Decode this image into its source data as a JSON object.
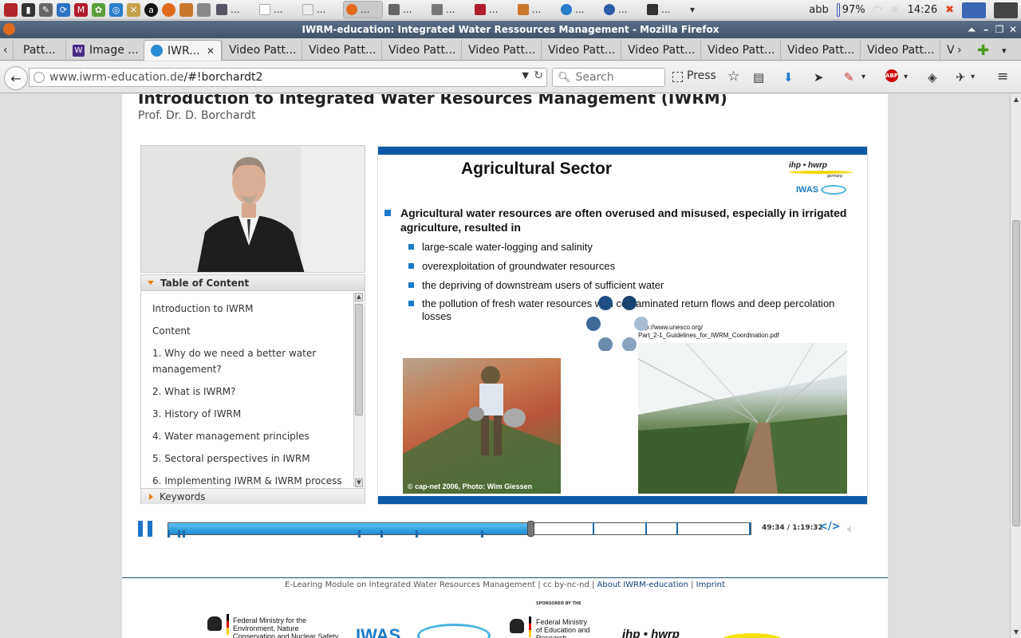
{
  "system_panel": {
    "battery": "97%",
    "clock": "14:26",
    "keyboard": "abb",
    "task_label": "..."
  },
  "window": {
    "title": "IWRM-education: Integrated Water Ressources Management - Mozilla Firefox"
  },
  "tabs": [
    {
      "label": "Patt..."
    },
    {
      "label": "Image ..."
    },
    {
      "label": "IWR..."
    },
    {
      "label": "Video Patt..."
    },
    {
      "label": "Video Patt..."
    },
    {
      "label": "Video Patt..."
    },
    {
      "label": "Video Patt..."
    },
    {
      "label": "Video Patt..."
    },
    {
      "label": "Video Patt..."
    },
    {
      "label": "Video Patt..."
    },
    {
      "label": "Video Patt..."
    },
    {
      "label": "Video Patt..."
    },
    {
      "label": "V"
    }
  ],
  "navbar": {
    "url_host": "www.iwrm-education.de",
    "url_path": "/#!borchardt2",
    "search_placeholder": "Search",
    "press_label": "Press"
  },
  "page": {
    "title": "Introduction to Integrated Water Resources Management (IWRM)",
    "author": "Prof. Dr. D. Borchardt",
    "toc_heading": "Table of Content",
    "toc_items": [
      "Introduction to IWRM",
      "Content",
      "1. Why do we need a better water management?",
      "2. What is IWRM?",
      "3. History of IWRM",
      "4. Water management principles",
      "5. Sectoral perspectives in IWRM",
      "6. Implementing IWRM & IWRM process"
    ],
    "keywords_label": "Keywords"
  },
  "slide": {
    "title": "Agricultural Sector",
    "logo_top": "ihp • hwrp",
    "logo_top_sub": "germany",
    "logo_bottom": "IWAS",
    "main_point": "Agricultural water resources are often overused and misused, especially in irrigated agriculture, resulted in",
    "sub_points": [
      "large-scale water-logging and salinity",
      "overexploitation of groundwater resources",
      "the depriving of downstream users of sufficient water",
      "the pollution of fresh water resources with contaminated return flows and deep percolation losses"
    ],
    "source_url_1": "http://www.unesco.org/",
    "source_url_2": "Part_2-1_Guidelines_for_IWRM_Coordination.pdf",
    "photo_caption": "© cap-net 2006, Photo: Wim Giessen"
  },
  "player": {
    "time": "49:34 / 1:19:32",
    "embed_label": "</>",
    "progress_fraction": 0.623
  },
  "footer": {
    "text": "E-Learing Module on Integrated Water Resources Management | cc by-nc-nd | ",
    "about_link": "About IWRM-education",
    "sep": " | ",
    "imprint_link": "Imprint",
    "sponsored": "SPONSORED BY THE",
    "ministry_env": "Federal Ministry for the Environment, Nature Conservation and Nuclear Safety",
    "ministry_edu": "Federal Ministry of Education and Research",
    "logo_iwas": "IWAS",
    "logo_ihp": "ihp • hwrp"
  },
  "colors": {
    "accent": "#1a74c6",
    "slide_blue": "#0c5aa6",
    "titlebar": "#4d5f77"
  }
}
